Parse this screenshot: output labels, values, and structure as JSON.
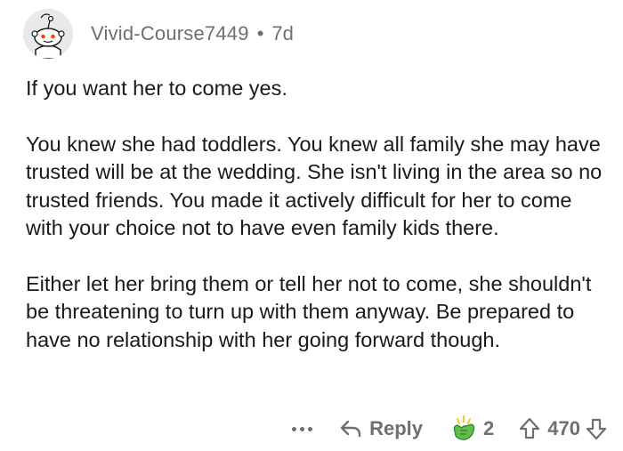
{
  "comment": {
    "username": "Vivid-Course7449",
    "separator": "•",
    "age": "7d",
    "paragraphs": [
      "If you want her to come yes.",
      "You knew she had toddlers. You knew all family she may have trusted will be at the wedding. She isn't living in the area so no trusted friends. You made it actively difficult for her to come with your choice not to have even family kids there.",
      "Either let her bring them or tell her not to come, she shouldn't be threatening to turn up with them anyway. Be prepared to have no relationship with her going forward though."
    ]
  },
  "actions": {
    "more_icon": "more-dots-icon",
    "reply_icon": "reply-arrow-icon",
    "reply_label": "Reply",
    "award_icon": "award-hands-icon",
    "award_count": "2",
    "upvote_icon": "upvote-arrow-icon",
    "score": "470",
    "downvote_icon": "downvote-arrow-icon"
  },
  "colors": {
    "text": "#1a1a1b",
    "muted": "#6d6f72",
    "background": "#ffffff",
    "award_green": "#4caf50"
  }
}
